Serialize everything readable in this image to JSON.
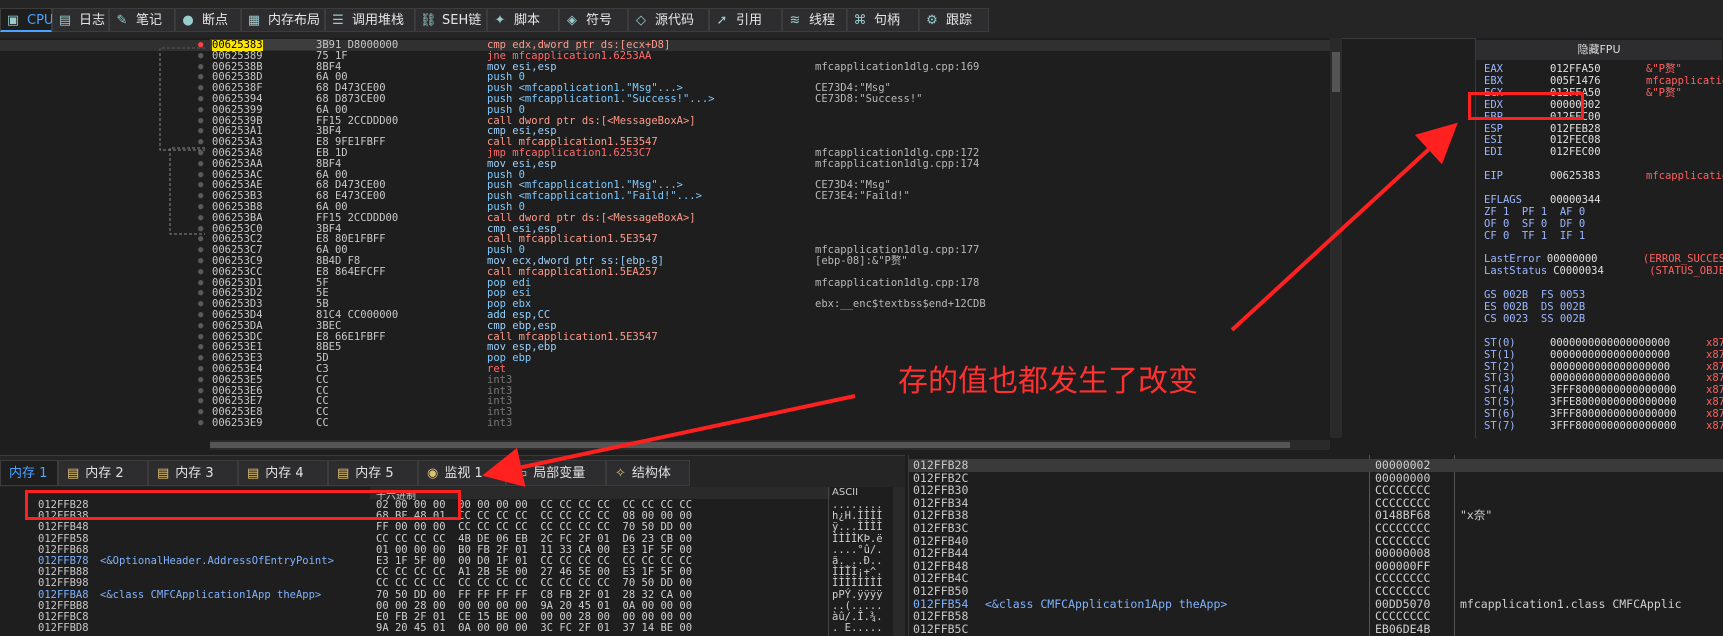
{
  "tabs": [
    {
      "label": "CPU",
      "icon": "cpu-icon"
    },
    {
      "label": "日志",
      "icon": "log-icon"
    },
    {
      "label": "笔记",
      "icon": "note-icon"
    },
    {
      "label": "断点",
      "icon": "breakpoint-icon"
    },
    {
      "label": "内存布局",
      "icon": "memory-map-icon"
    },
    {
      "label": "调用堆栈",
      "icon": "callstack-icon"
    },
    {
      "label": "SEH链",
      "icon": "seh-icon"
    },
    {
      "label": "脚本",
      "icon": "script-icon"
    },
    {
      "label": "符号",
      "icon": "symbol-icon"
    },
    {
      "label": "源代码",
      "icon": "source-icon"
    },
    {
      "label": "引用",
      "icon": "reference-icon"
    },
    {
      "label": "线程",
      "icon": "thread-icon"
    },
    {
      "label": "句柄",
      "icon": "handle-icon"
    },
    {
      "label": "跟踪",
      "icon": "trace-icon"
    }
  ],
  "disasm": [
    {
      "addr": "00625383",
      "bytes": "3B91 D8000000",
      "instr": "cmp edx,dword ptr ds:[ecx+D8]",
      "k": "c",
      "cmt": ""
    },
    {
      "addr": "00625389",
      "bytes": "75 1F",
      "instr": "jne mfcapplication1.6253AA",
      "k": "j",
      "cmt": ""
    },
    {
      "addr": "0062538B",
      "bytes": "8BF4",
      "instr": "mov esi,esp",
      "k": "m",
      "cmt": "mfcapplication1dlg.cpp:169"
    },
    {
      "addr": "0062538D",
      "bytes": "6A 00",
      "instr": "push 0",
      "k": "p",
      "cmt": ""
    },
    {
      "addr": "0062538F",
      "bytes": "68 D473CE00",
      "instr": "push <mfcapplication1.\"Msg\"...>",
      "k": "p",
      "cmt": "CE73D4:\"Msg\""
    },
    {
      "addr": "00625394",
      "bytes": "68 D873CE00",
      "instr": "push <mfcapplication1.\"Success!\"...>",
      "k": "p",
      "cmt": "CE73D8:\"Success!\""
    },
    {
      "addr": "00625399",
      "bytes": "6A 00",
      "instr": "push 0",
      "k": "p",
      "cmt": ""
    },
    {
      "addr": "0062539B",
      "bytes": "FF15 2CCDDD00",
      "instr": "call dword ptr ds:[<MessageBoxA>]",
      "k": "c",
      "cmt": ""
    },
    {
      "addr": "006253A1",
      "bytes": "3BF4",
      "instr": "cmp esi,esp",
      "k": "m",
      "cmt": ""
    },
    {
      "addr": "006253A3",
      "bytes": "E8 9FE1FBFF",
      "instr": "call mfcapplication1.5E3547",
      "k": "c",
      "cmt": ""
    },
    {
      "addr": "006253A8",
      "bytes": "EB 1D",
      "instr": "jmp mfcapplication1.6253C7",
      "k": "j",
      "cmt": "mfcapplication1dlg.cpp:172"
    },
    {
      "addr": "006253AA",
      "bytes": "8BF4",
      "instr": "mov esi,esp",
      "k": "m",
      "cmt": "mfcapplication1dlg.cpp:174"
    },
    {
      "addr": "006253AC",
      "bytes": "6A 00",
      "instr": "push 0",
      "k": "p",
      "cmt": ""
    },
    {
      "addr": "006253AE",
      "bytes": "68 D473CE00",
      "instr": "push <mfcapplication1.\"Msg\"...>",
      "k": "p",
      "cmt": "CE73D4:\"Msg\""
    },
    {
      "addr": "006253B3",
      "bytes": "68 E473CE00",
      "instr": "push <mfcapplication1.\"Faild!\"...>",
      "k": "p",
      "cmt": "CE73E4:\"Faild!\""
    },
    {
      "addr": "006253B8",
      "bytes": "6A 00",
      "instr": "push 0",
      "k": "p",
      "cmt": ""
    },
    {
      "addr": "006253BA",
      "bytes": "FF15 2CCDDD00",
      "instr": "call dword ptr ds:[<MessageBoxA>]",
      "k": "c",
      "cmt": ""
    },
    {
      "addr": "006253C0",
      "bytes": "3BF4",
      "instr": "cmp esi,esp",
      "k": "m",
      "cmt": ""
    },
    {
      "addr": "006253C2",
      "bytes": "E8 80E1FBFF",
      "instr": "call mfcapplication1.5E3547",
      "k": "c",
      "cmt": ""
    },
    {
      "addr": "006253C7",
      "bytes": "6A 00",
      "instr": "push 0",
      "k": "p",
      "cmt": "mfcapplication1dlg.cpp:177"
    },
    {
      "addr": "006253C9",
      "bytes": "8B4D F8",
      "instr": "mov ecx,dword ptr ss:[ebp-8]",
      "k": "m",
      "cmt": "[ebp-08]:&\"P赘\""
    },
    {
      "addr": "006253CC",
      "bytes": "E8 864EFCFF",
      "instr": "call mfcapplication1.5EA257",
      "k": "c",
      "cmt": ""
    },
    {
      "addr": "006253D1",
      "bytes": "5F",
      "instr": "pop edi",
      "k": "p",
      "cmt": "mfcapplication1dlg.cpp:178"
    },
    {
      "addr": "006253D2",
      "bytes": "5E",
      "instr": "pop esi",
      "k": "p",
      "cmt": ""
    },
    {
      "addr": "006253D3",
      "bytes": "5B",
      "instr": "pop ebx",
      "k": "p",
      "cmt": "ebx:__enc$textbss$end+12CDB"
    },
    {
      "addr": "006253D4",
      "bytes": "81C4 CC000000",
      "instr": "add esp,CC",
      "k": "a",
      "cmt": ""
    },
    {
      "addr": "006253DA",
      "bytes": "3BEC",
      "instr": "cmp ebp,esp",
      "k": "m",
      "cmt": ""
    },
    {
      "addr": "006253DC",
      "bytes": "E8 66E1FBFF",
      "instr": "call mfcapplication1.5E3547",
      "k": "c",
      "cmt": ""
    },
    {
      "addr": "006253E1",
      "bytes": "8BE5",
      "instr": "mov esp,ebp",
      "k": "m",
      "cmt": ""
    },
    {
      "addr": "006253E3",
      "bytes": "5D",
      "instr": "pop ebp",
      "k": "p",
      "cmt": ""
    },
    {
      "addr": "006253E4",
      "bytes": "C3",
      "instr": "ret",
      "k": "r",
      "cmt": ""
    },
    {
      "addr": "006253E5",
      "bytes": "CC",
      "instr": "int3",
      "k": "i",
      "cmt": ""
    },
    {
      "addr": "006253E6",
      "bytes": "CC",
      "instr": "int3",
      "k": "i",
      "cmt": ""
    },
    {
      "addr": "006253E7",
      "bytes": "CC",
      "instr": "int3",
      "k": "i",
      "cmt": ""
    },
    {
      "addr": "006253E8",
      "bytes": "CC",
      "instr": "int3",
      "k": "i",
      "cmt": ""
    },
    {
      "addr": "006253E9",
      "bytes": "CC",
      "instr": "int3",
      "k": "i",
      "cmt": ""
    }
  ],
  "registers": {
    "hide_fpu": "隐藏FPU",
    "lines": [
      {
        "n": "EAX",
        "v": "012FFA50",
        "c": "&\"P赘\""
      },
      {
        "n": "EBX",
        "v": "005F1476",
        "c": "mfcapplication1."
      },
      {
        "n": "ECX",
        "v": "012FFA50",
        "c": "&\"P赘\""
      },
      {
        "n": "EDX",
        "v": "00000002",
        "c": ""
      },
      {
        "n": "EBP",
        "v": "012FEC00",
        "c": ""
      },
      {
        "n": "ESP",
        "v": "012FEB28",
        "c": ""
      },
      {
        "n": "ESI",
        "v": "012FEC08",
        "c": ""
      },
      {
        "n": "EDI",
        "v": "012FEC00",
        "c": ""
      },
      {
        "n": "",
        "v": "",
        "c": ""
      },
      {
        "n": "EIP",
        "v": "00625383",
        "c": "mfcapplication1."
      },
      {
        "n": "",
        "v": "",
        "c": ""
      },
      {
        "n": "EFLAGS",
        "v": "00000344",
        "c": ""
      },
      {
        "n": "ZF 1  PF 1  AF 0",
        "v": "",
        "c": ""
      },
      {
        "n": "OF 0  SF 0  DF 0",
        "v": "",
        "c": ""
      },
      {
        "n": "CF 0  TF 1  IF 1",
        "v": "",
        "c": ""
      },
      {
        "n": "",
        "v": "",
        "c": ""
      },
      {
        "n": "LastError",
        "v": "00000000",
        "c": "(ERROR_SUCCESS)"
      },
      {
        "n": "LastStatus",
        "v": "C0000034",
        "c": "(STATUS_OBJECT_"
      },
      {
        "n": "",
        "v": "",
        "c": ""
      },
      {
        "n": "GS 002B  FS 0053",
        "v": "",
        "c": ""
      },
      {
        "n": "ES 002B  DS 002B",
        "v": "",
        "c": ""
      },
      {
        "n": "CS 0023  SS 002B",
        "v": "",
        "c": ""
      },
      {
        "n": "",
        "v": "",
        "c": ""
      },
      {
        "n": "ST(0)",
        "v": "0000000000000000000",
        "c": "x87r0"
      },
      {
        "n": "ST(1)",
        "v": "0000000000000000000",
        "c": "x87r1"
      },
      {
        "n": "ST(2)",
        "v": "0000000000000000000",
        "c": "x87r2"
      },
      {
        "n": "ST(3)",
        "v": "0000000000000000000",
        "c": "x87r3"
      },
      {
        "n": "ST(4)",
        "v": "3FFF8000000000000000",
        "c": "x87r4"
      },
      {
        "n": "ST(5)",
        "v": "3FFE8000000000000000",
        "c": "x87r5"
      },
      {
        "n": "ST(6)",
        "v": "3FFF8000000000000000",
        "c": "x87r6"
      },
      {
        "n": "ST(7)",
        "v": "3FFF8000000000000000",
        "c": "x87r7"
      }
    ]
  },
  "bottom_tabs": [
    {
      "label": "内存 1",
      "icon": "memory-icon"
    },
    {
      "label": "内存 2",
      "icon": "memory-icon"
    },
    {
      "label": "内存 3",
      "icon": "memory-icon"
    },
    {
      "label": "内存 4",
      "icon": "memory-icon"
    },
    {
      "label": "内存 5",
      "icon": "memory-icon"
    },
    {
      "label": "监视 1",
      "icon": "watch-icon"
    },
    {
      "label": "局部变量",
      "icon": "locals-icon"
    },
    {
      "label": "结构体",
      "icon": "struct-icon"
    }
  ],
  "dump": {
    "header_hex": "十六进制",
    "header_ascii": "ASCII",
    "rows": [
      {
        "addr": "012FFB28",
        "lbl": "",
        "hex": "02 00 00 00  00 00 00 00  CC CC CC CC  CC CC CC CC",
        "ascii": "........"
      },
      {
        "addr": "012FFB38",
        "lbl": "",
        "hex": "68 BF 48 01  CC CC CC CC  CC CC CC CC  08 00 00 00",
        "ascii": "h¿H.ÌÌÌÌ"
      },
      {
        "addr": "012FFB48",
        "lbl": "",
        "hex": "FF 00 00 00  CC CC CC CC  CC CC CC CC  70 50 DD 00",
        "ascii": "ÿ...ÌÌÌÌ"
      },
      {
        "addr": "012FFB58",
        "lbl": "",
        "hex": "CC CC CC CC  4B DE 06 EB  2C FC 2F 01  D6 23 CB 00",
        "ascii": "ÌÌÌÌKÞ.ë"
      },
      {
        "addr": "012FFB68",
        "lbl": "",
        "hex": "01 00 00 00  B0 FB 2F 01  11 33 CA 00  E3 1F 5F 00",
        "ascii": "....°û/."
      },
      {
        "addr": "012FFB78",
        "lbl": "<&OptionalHeader.AddressOfEntryPoint>",
        "hex": "E3 1F 5F 00  00 D0 1F 01  CC CC CC CC  CC CC CC CC",
        "ascii": "ã._..Ð.."
      },
      {
        "addr": "012FFB88",
        "lbl": "",
        "hex": "CC CC CC CC  A1 2B 5E 00  27 46 5E 00  E3 1F 5F 00",
        "ascii": "ÌÌÌÌ¡+^."
      },
      {
        "addr": "012FFB98",
        "lbl": "",
        "hex": "CC CC CC CC  CC CC CC CC  CC CC CC CC  70 50 DD 00",
        "ascii": "ÌÌÌÌÌÌÌÌ"
      },
      {
        "addr": "012FFBA8",
        "lbl": "<&class CMFCApplication1App theApp>",
        "hex": "70 50 DD 00  FF FF FF FF  C8 FB 2F 01  28 32 CA 00",
        "ascii": "pPÝ.ÿÿÿÿ"
      },
      {
        "addr": "012FFBB8",
        "lbl": "",
        "hex": "00 00 28 00  00 00 00 00  9A 20 45 01  0A 00 00 00",
        "ascii": "..(....."
      },
      {
        "addr": "012FFBC8",
        "lbl": "",
        "hex": "E0 FB 2F 01  CE 15 BE 00  00 00 28 00  00 00 00 00",
        "ascii": "àû/.Î.¾."
      },
      {
        "addr": "012FFBD8",
        "lbl": "",
        "hex": "9A 20 45 01  0A 00 00 00  3C FC 2F 01  37 14 BE 00",
        "ascii": ". E....."
      }
    ]
  },
  "stack": [
    {
      "addr": "012FFB28",
      "lbl": "",
      "val": "00000002",
      "cmt": ""
    },
    {
      "addr": "012FFB2C",
      "lbl": "",
      "val": "00000000",
      "cmt": ""
    },
    {
      "addr": "012FFB30",
      "lbl": "",
      "val": "CCCCCCCC",
      "cmt": ""
    },
    {
      "addr": "012FFB34",
      "lbl": "",
      "val": "CCCCCCCC",
      "cmt": ""
    },
    {
      "addr": "012FFB38",
      "lbl": "",
      "val": "0148BF68",
      "cmt": "\"x奈\""
    },
    {
      "addr": "012FFB3C",
      "lbl": "",
      "val": "CCCCCCCC",
      "cmt": ""
    },
    {
      "addr": "012FFB40",
      "lbl": "",
      "val": "CCCCCCCC",
      "cmt": ""
    },
    {
      "addr": "012FFB44",
      "lbl": "",
      "val": "00000008",
      "cmt": ""
    },
    {
      "addr": "012FFB48",
      "lbl": "",
      "val": "000000FF",
      "cmt": ""
    },
    {
      "addr": "012FFB4C",
      "lbl": "",
      "val": "CCCCCCCC",
      "cmt": ""
    },
    {
      "addr": "012FFB50",
      "lbl": "",
      "val": "CCCCCCCC",
      "cmt": ""
    },
    {
      "addr": "012FFB54",
      "lbl": "<&class CMFCApplication1App theApp>",
      "val": "00DD5070",
      "cmt": "mfcapplication1.class CMFCApplic"
    },
    {
      "addr": "012FFB58",
      "lbl": "",
      "val": "CCCCCCCC",
      "cmt": ""
    },
    {
      "addr": "012FFB5C",
      "lbl": "",
      "val": "EB06DE4B",
      "cmt": ""
    }
  ],
  "annotation": {
    "text": "存的值也都发生了改变"
  }
}
